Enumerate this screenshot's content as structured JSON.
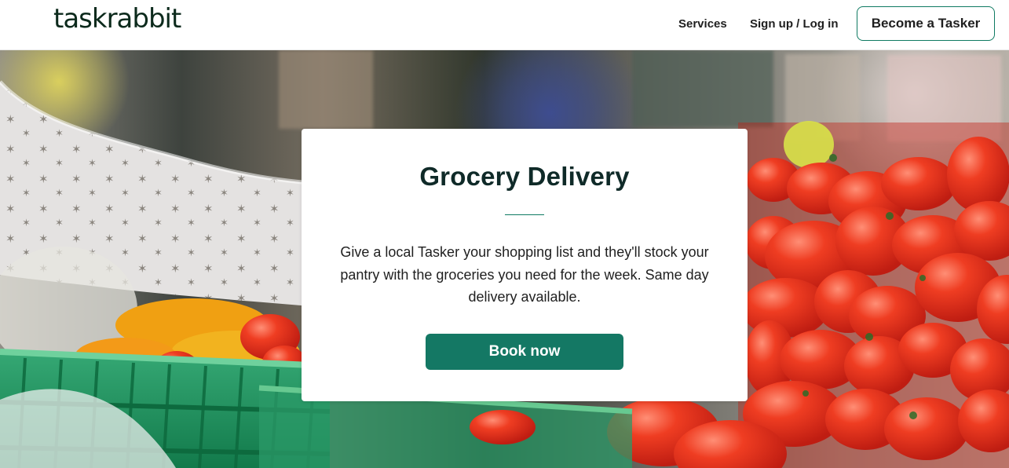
{
  "header": {
    "logo_text": "taskrabbit",
    "nav": {
      "services_label": "Services",
      "signup_login_label": "Sign up / Log in",
      "become_tasker_label": "Become a Tasker"
    }
  },
  "hero": {
    "title": "Grocery Delivery",
    "description": "Give a local Tasker your shopping list and they'll stock your pantry with the groceries you need for the week. Same day delivery available.",
    "cta_label": "Book now"
  },
  "colors": {
    "brand_green": "#147864",
    "text_dark": "#0f2a28",
    "header_border": "#e8e8e8"
  }
}
